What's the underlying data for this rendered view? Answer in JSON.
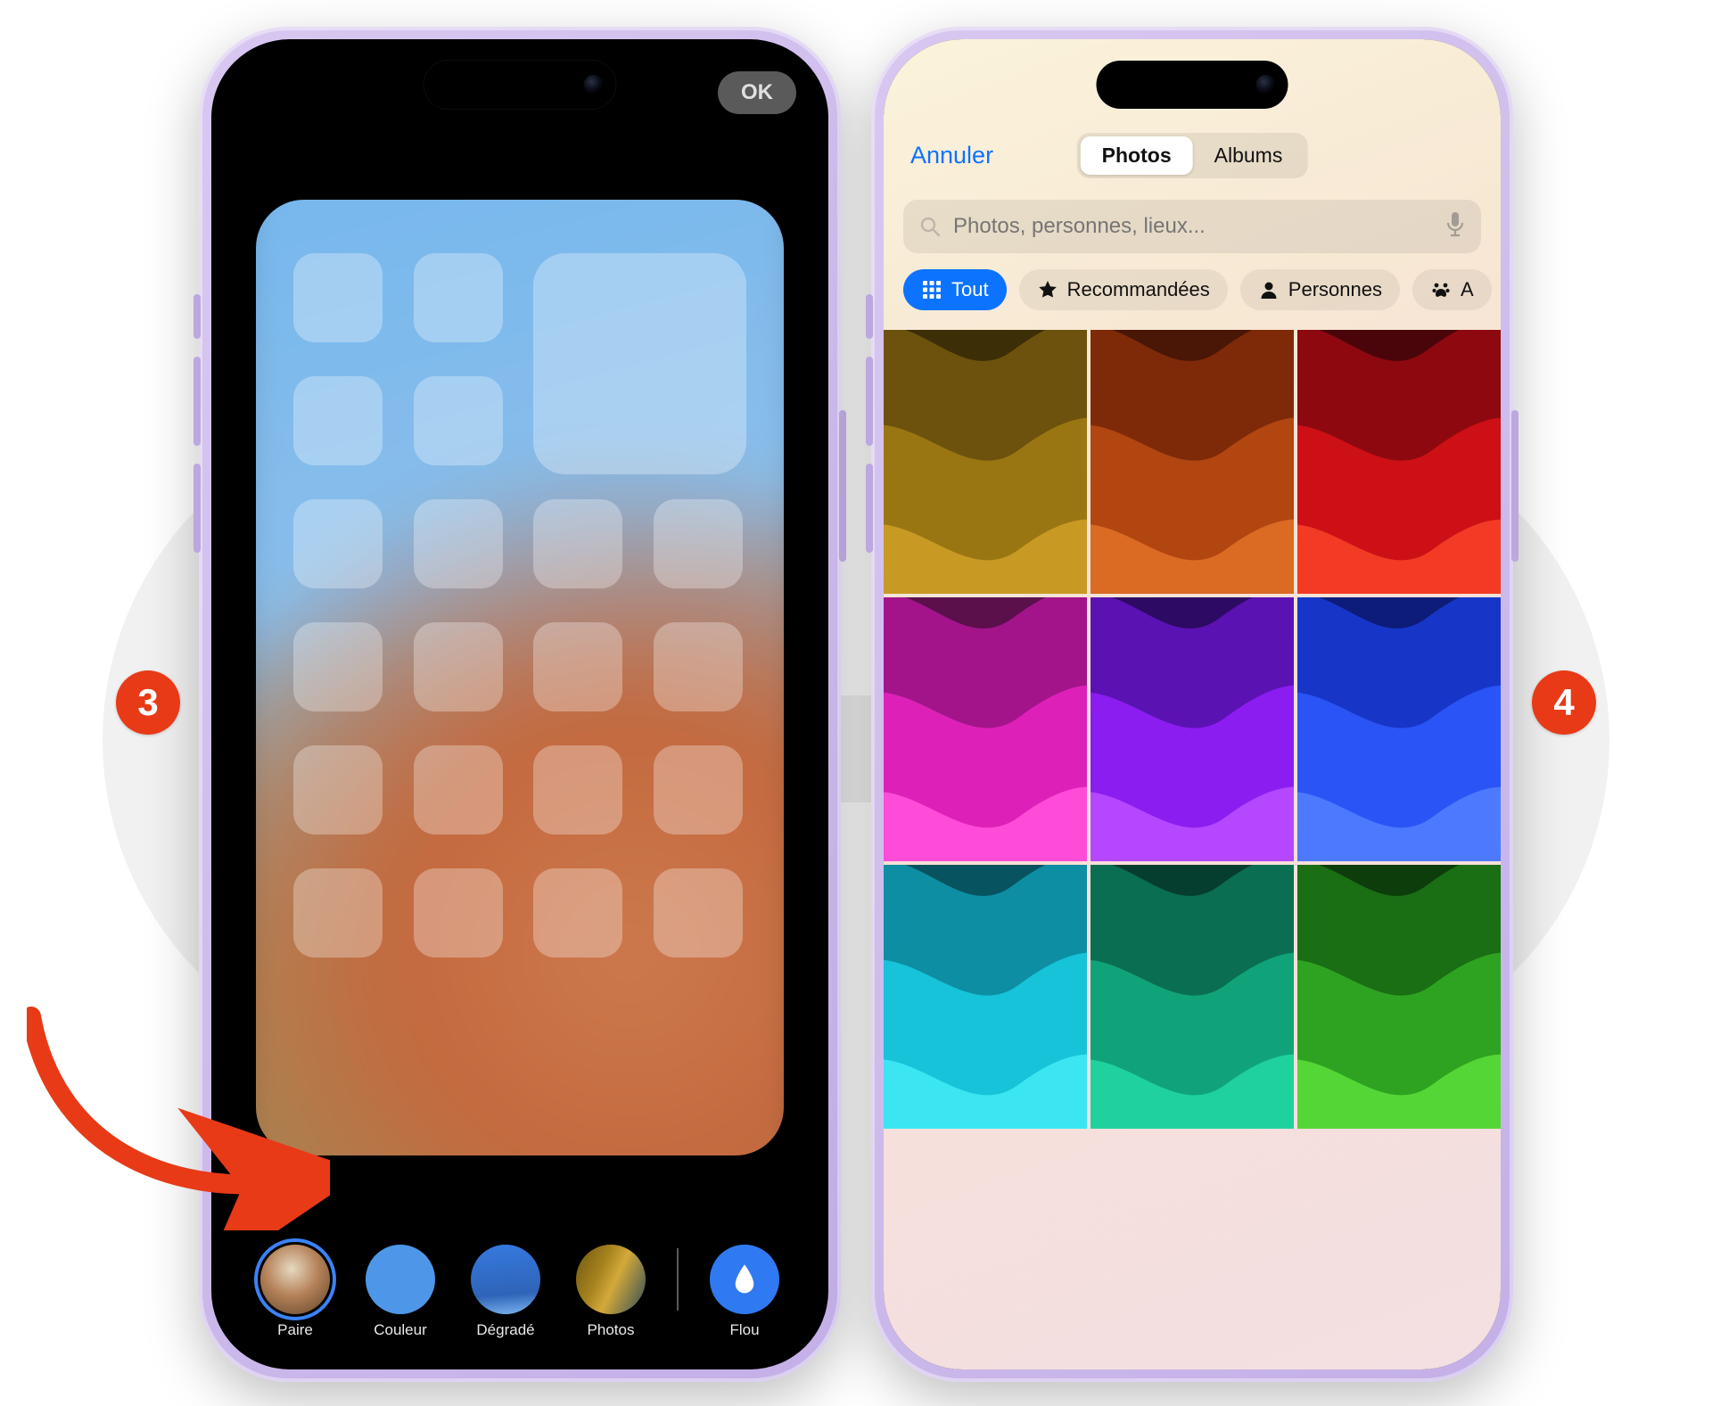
{
  "steps": {
    "left": "3",
    "right": "4"
  },
  "left": {
    "ok": "OK",
    "dock": {
      "paire": "Paire",
      "couleur": "Couleur",
      "degrade": "Dégradé",
      "photos": "Photos",
      "flou": "Flou"
    }
  },
  "right": {
    "cancel": "Annuler",
    "segments": {
      "photos": "Photos",
      "albums": "Albums"
    },
    "search_placeholder": "Photos, personnes, lieux...",
    "filters": {
      "all": "Tout",
      "recommended": "Recommandées",
      "people": "Personnes",
      "overflow": "A"
    }
  }
}
